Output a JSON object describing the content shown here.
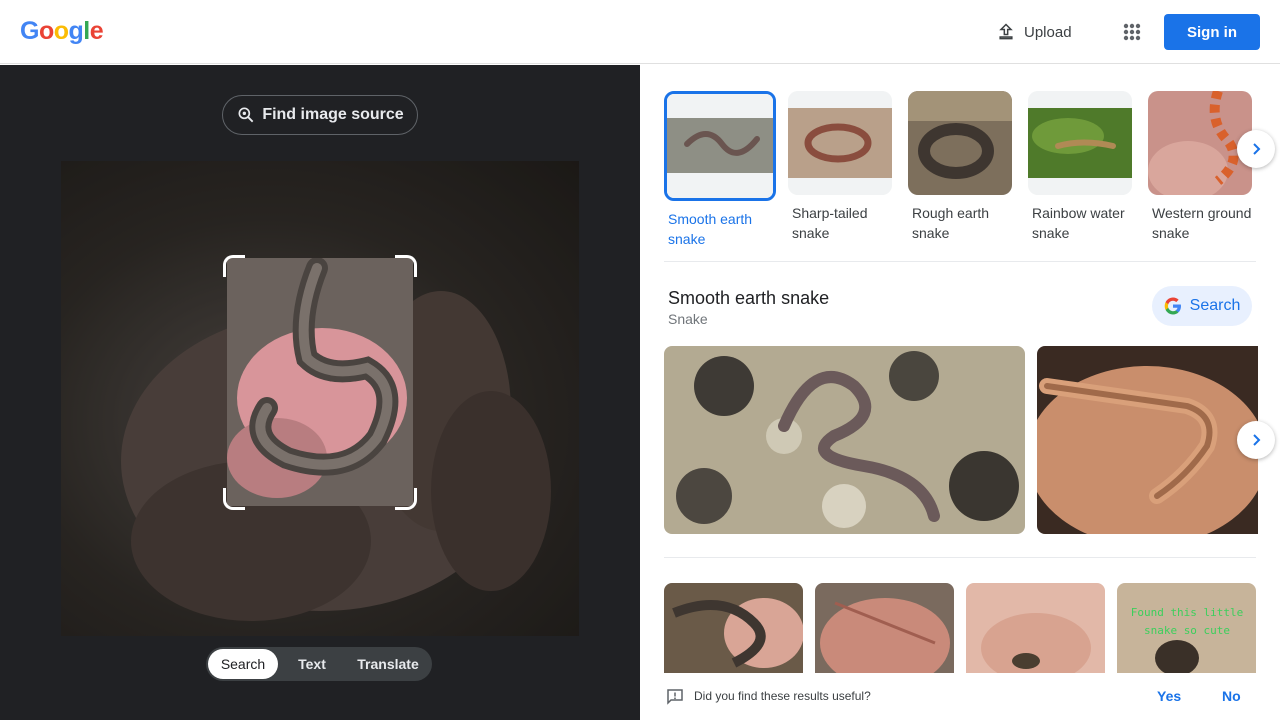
{
  "header": {
    "logo_letters": [
      {
        "ch": "G",
        "color": "#4285F4"
      },
      {
        "ch": "o",
        "color": "#EA4335"
      },
      {
        "ch": "o",
        "color": "#FBBC05"
      },
      {
        "ch": "g",
        "color": "#4285F4"
      },
      {
        "ch": "l",
        "color": "#34A853"
      },
      {
        "ch": "e",
        "color": "#EA4335"
      }
    ],
    "upload_label": "Upload",
    "apps_icon": "apps-grid-icon",
    "signin_label": "Sign in"
  },
  "lens": {
    "find_source_label": "Find image source",
    "modes": [
      "Search",
      "Text",
      "Translate"
    ],
    "active_mode": "Search"
  },
  "results": {
    "chips": [
      {
        "label": "Smooth earth snake",
        "active": true
      },
      {
        "label": "Sharp-tailed snake",
        "active": false
      },
      {
        "label": "Rough earth snake",
        "active": false
      },
      {
        "label": "Rainbow water snake",
        "active": false
      },
      {
        "label": "Western ground snake",
        "active": false
      }
    ],
    "entity": {
      "title": "Smooth earth snake",
      "subtitle": "Snake",
      "search_label": "Search"
    },
    "image_caption_text": "Found this little snake so cute",
    "feedback": {
      "question": "Did you find these results useful?",
      "yes": "Yes",
      "no": "No"
    }
  },
  "colors": {
    "accent": "#1a73e8",
    "dark_panel": "#202124"
  }
}
